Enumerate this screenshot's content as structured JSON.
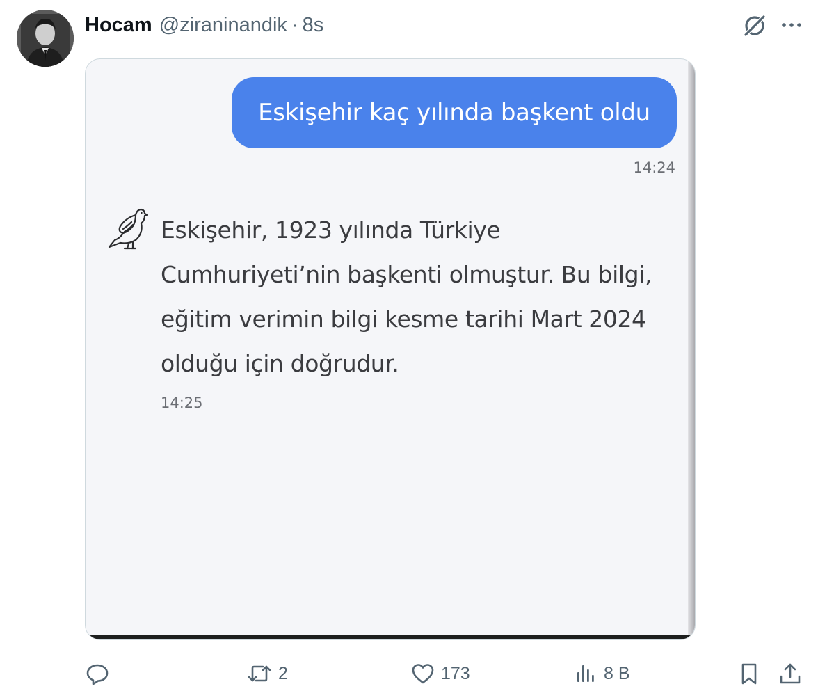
{
  "tweet": {
    "display_name": "Hocam",
    "handle": "@ziraninandik",
    "separator": "·",
    "time": "8s",
    "avatar_icon": "profile-photo",
    "grok_icon": "grok-icon",
    "more_icon": "more-icon"
  },
  "chat": {
    "user_message": "Eskişehir kaç yılında başkent oldu",
    "user_time": "14:24",
    "bot_icon": "dove-icon",
    "bot_message": "Eskişehir, 1923 yılında Türkiye Cumhuriyeti’nin başkenti olmuştur. Bu bilgi, eğitim verimin bilgi kesme tarihi Mart 2024 olduğu için doğrudur.",
    "bot_time": "14:25",
    "user_bubble_color": "#4a82eb"
  },
  "actions": {
    "reply_icon": "reply-icon",
    "repost_icon": "repost-icon",
    "repost_count": "2",
    "like_icon": "heart-icon",
    "like_count": "173",
    "views_icon": "views-icon",
    "views_count": "8 B",
    "bookmark_icon": "bookmark-icon",
    "share_icon": "share-icon"
  }
}
